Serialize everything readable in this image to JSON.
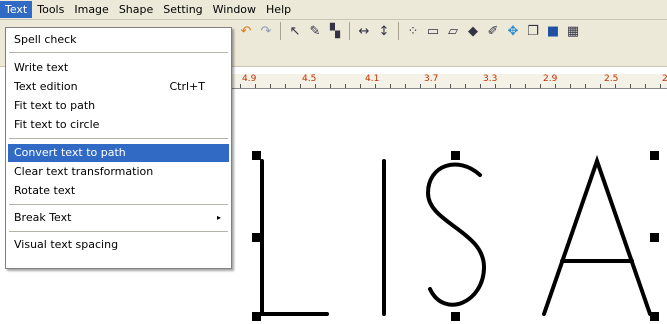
{
  "menubar": {
    "items": [
      {
        "label": "Text"
      },
      {
        "label": "Tools"
      },
      {
        "label": "Image"
      },
      {
        "label": "Shape"
      },
      {
        "label": "Setting"
      },
      {
        "label": "Window"
      },
      {
        "label": "Help"
      }
    ]
  },
  "menu": {
    "items": [
      {
        "label": "Spell check"
      },
      {
        "label": "Write text"
      },
      {
        "label": "Text edition",
        "shortcut": "Ctrl+T"
      },
      {
        "label": "Fit text to path"
      },
      {
        "label": "Fit text to circle"
      },
      {
        "label": "Convert text to path"
      },
      {
        "label": "Clear text transformation"
      },
      {
        "label": "Rotate text"
      },
      {
        "label": "Break Text",
        "submenu_arrow": "▸"
      },
      {
        "label": "Visual text spacing"
      }
    ]
  },
  "ruler": {
    "labels": [
      "4.9",
      "4.5",
      "4.1",
      "3.7",
      "3.3",
      "2.9",
      "2.5",
      "2"
    ]
  },
  "toolbar": {
    "icons": [
      "undo-icon",
      "redo-icon",
      "pointer-icon",
      "node-edit-icon",
      "align-icon",
      "flip-horizontal-icon",
      "flip-vertical-icon",
      "group-icon",
      "rectangle-icon",
      "eraser-icon",
      "fill-icon",
      "color-picker-icon",
      "move-icon",
      "copy-icon",
      "layer-icon",
      "grid-icon"
    ]
  },
  "colors": {
    "menu_highlight": "#316ac5",
    "chrome": "#ece9d8",
    "ruler_label": "#c03000"
  }
}
